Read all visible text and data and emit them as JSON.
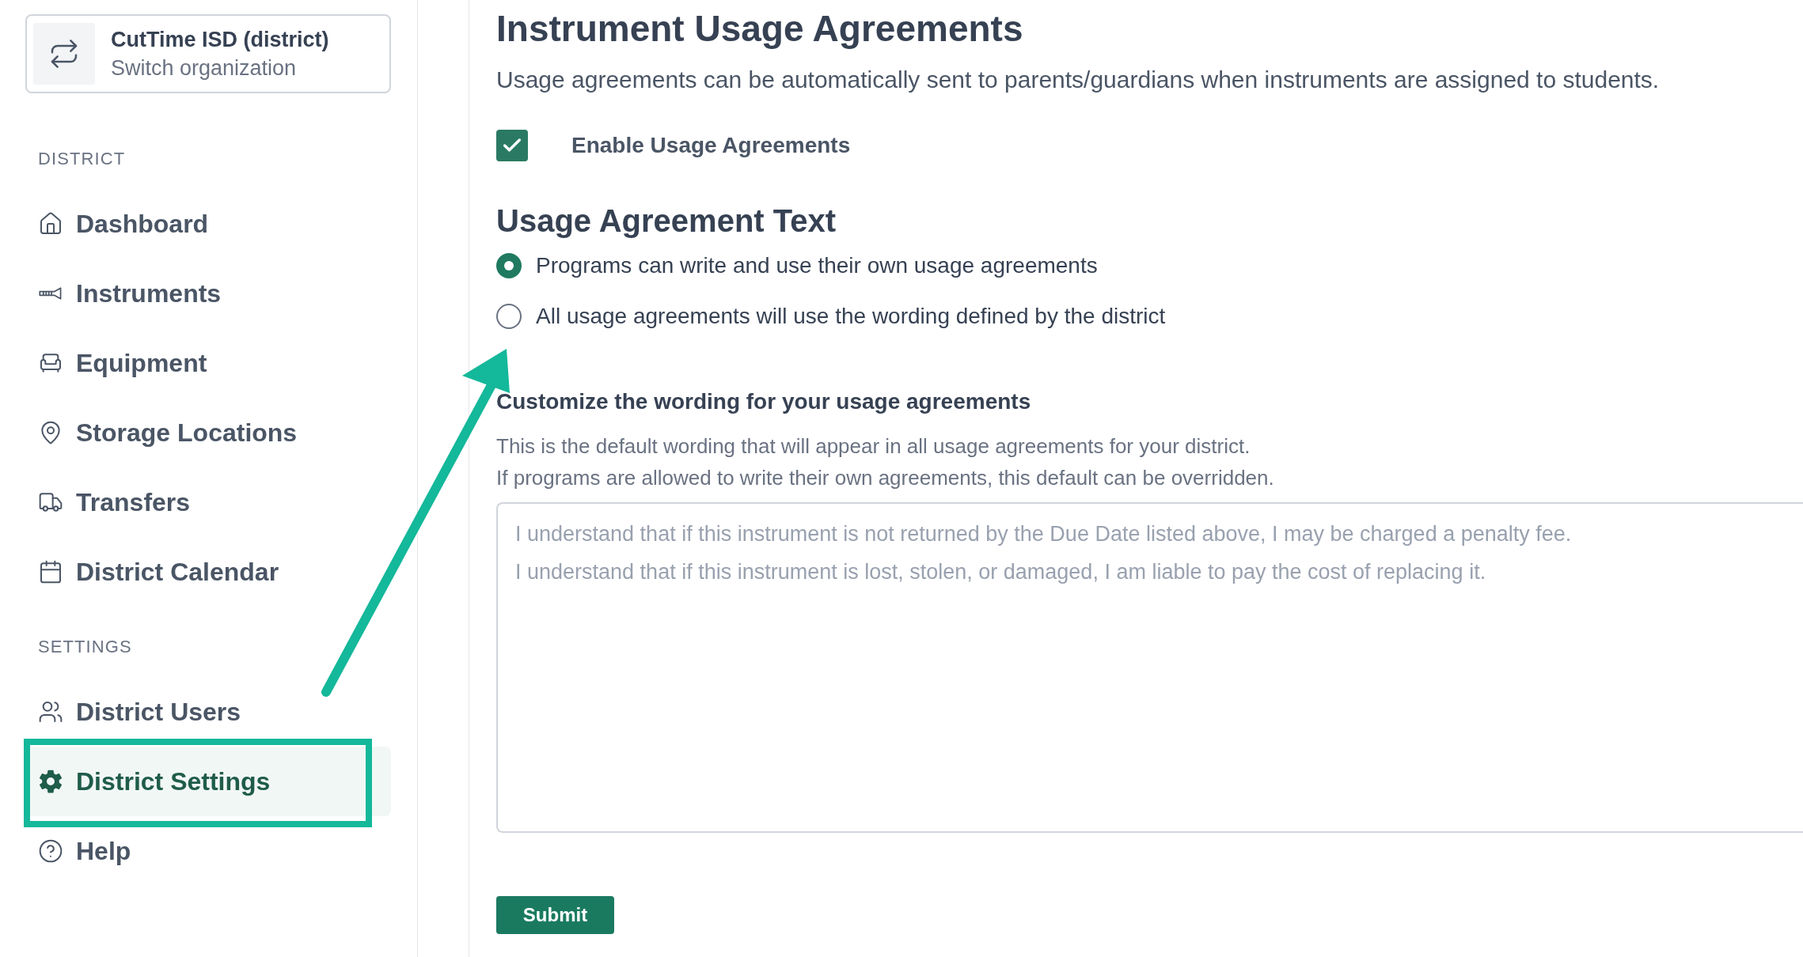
{
  "org": {
    "name": "CutTime ISD (district)",
    "subtitle": "Switch organization"
  },
  "sidebar": {
    "sections": [
      {
        "heading": "DISTRICT",
        "items": [
          {
            "label": "Dashboard",
            "selected": false
          },
          {
            "label": "Instruments",
            "selected": false
          },
          {
            "label": "Equipment",
            "selected": false
          },
          {
            "label": "Storage Locations",
            "selected": false
          },
          {
            "label": "Transfers",
            "selected": false
          },
          {
            "label": "District Calendar",
            "selected": false
          }
        ]
      },
      {
        "heading": "SETTINGS",
        "items": [
          {
            "label": "District Users",
            "selected": false
          },
          {
            "label": "District Settings",
            "selected": true
          },
          {
            "label": "Help",
            "selected": false
          }
        ]
      }
    ]
  },
  "main": {
    "title": "Instrument Usage Agreements",
    "description": "Usage agreements can be automatically sent to parents/guardians when instruments are assigned to students.",
    "enable": {
      "label": "Enable Usage Agreements",
      "checked": true
    },
    "agreement_text": {
      "heading": "Usage Agreement Text",
      "options": [
        {
          "label": "Programs can write and use their own usage agreements",
          "selected": true
        },
        {
          "label": "All usage agreements will use the wording defined by the district",
          "selected": false
        }
      ]
    },
    "customize": {
      "label": "Customize the wording for your usage agreements",
      "help": [
        "This is the default wording that will appear in all usage agreements for your district.",
        "If programs are allowed to write their own agreements, this default can be overridden."
      ],
      "placeholder": "I understand that if this instrument is not returned by the Due Date listed above, I may be charged a penalty fee.\nI understand that if this instrument is lost, stolen, or damaged, I am liable to pay the cost of replacing it."
    },
    "submit": "Submit"
  }
}
